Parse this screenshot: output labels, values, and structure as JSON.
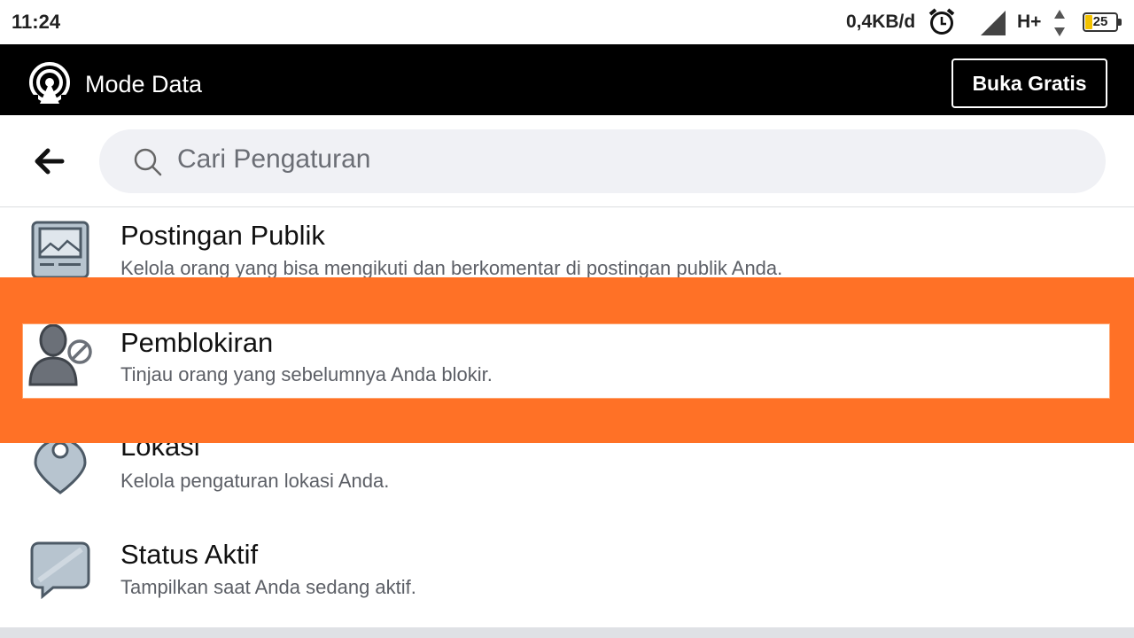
{
  "status_bar": {
    "time": "11:24",
    "data_speed": "0,4KB/d",
    "network_type": "H+",
    "battery_level": "25",
    "icons": [
      "alarm-icon",
      "signal-icon",
      "data-arrows-icon",
      "battery-icon"
    ]
  },
  "mode_bar": {
    "title": "Mode Data",
    "free_button_label": "Buka Gratis",
    "icon": "broadcast-icon"
  },
  "search": {
    "placeholder": "Cari Pengaturan",
    "back_icon": "back-arrow-icon"
  },
  "settings": {
    "items": [
      {
        "title": "Postingan Publik",
        "description": "Kelola orang yang bisa mengikuti dan berkomentar di postingan publik Anda.",
        "icon": "public-posts-icon"
      },
      {
        "title": "Pemblokiran",
        "description": "Tinjau orang yang sebelumnya Anda blokir.",
        "icon": "blocked-user-icon",
        "highlighted": true
      },
      {
        "title": "Lokasi",
        "description": "Kelola pengaturan lokasi Anda.",
        "icon": "location-pin-icon"
      },
      {
        "title": "Status Aktif",
        "description": "Tampilkan saat Anda sedang aktif.",
        "icon": "chat-bubble-icon"
      }
    ]
  },
  "colors": {
    "highlight": "#ff7126",
    "mode_bar_bg": "#000000",
    "search_bg": "#f0f1f5"
  }
}
